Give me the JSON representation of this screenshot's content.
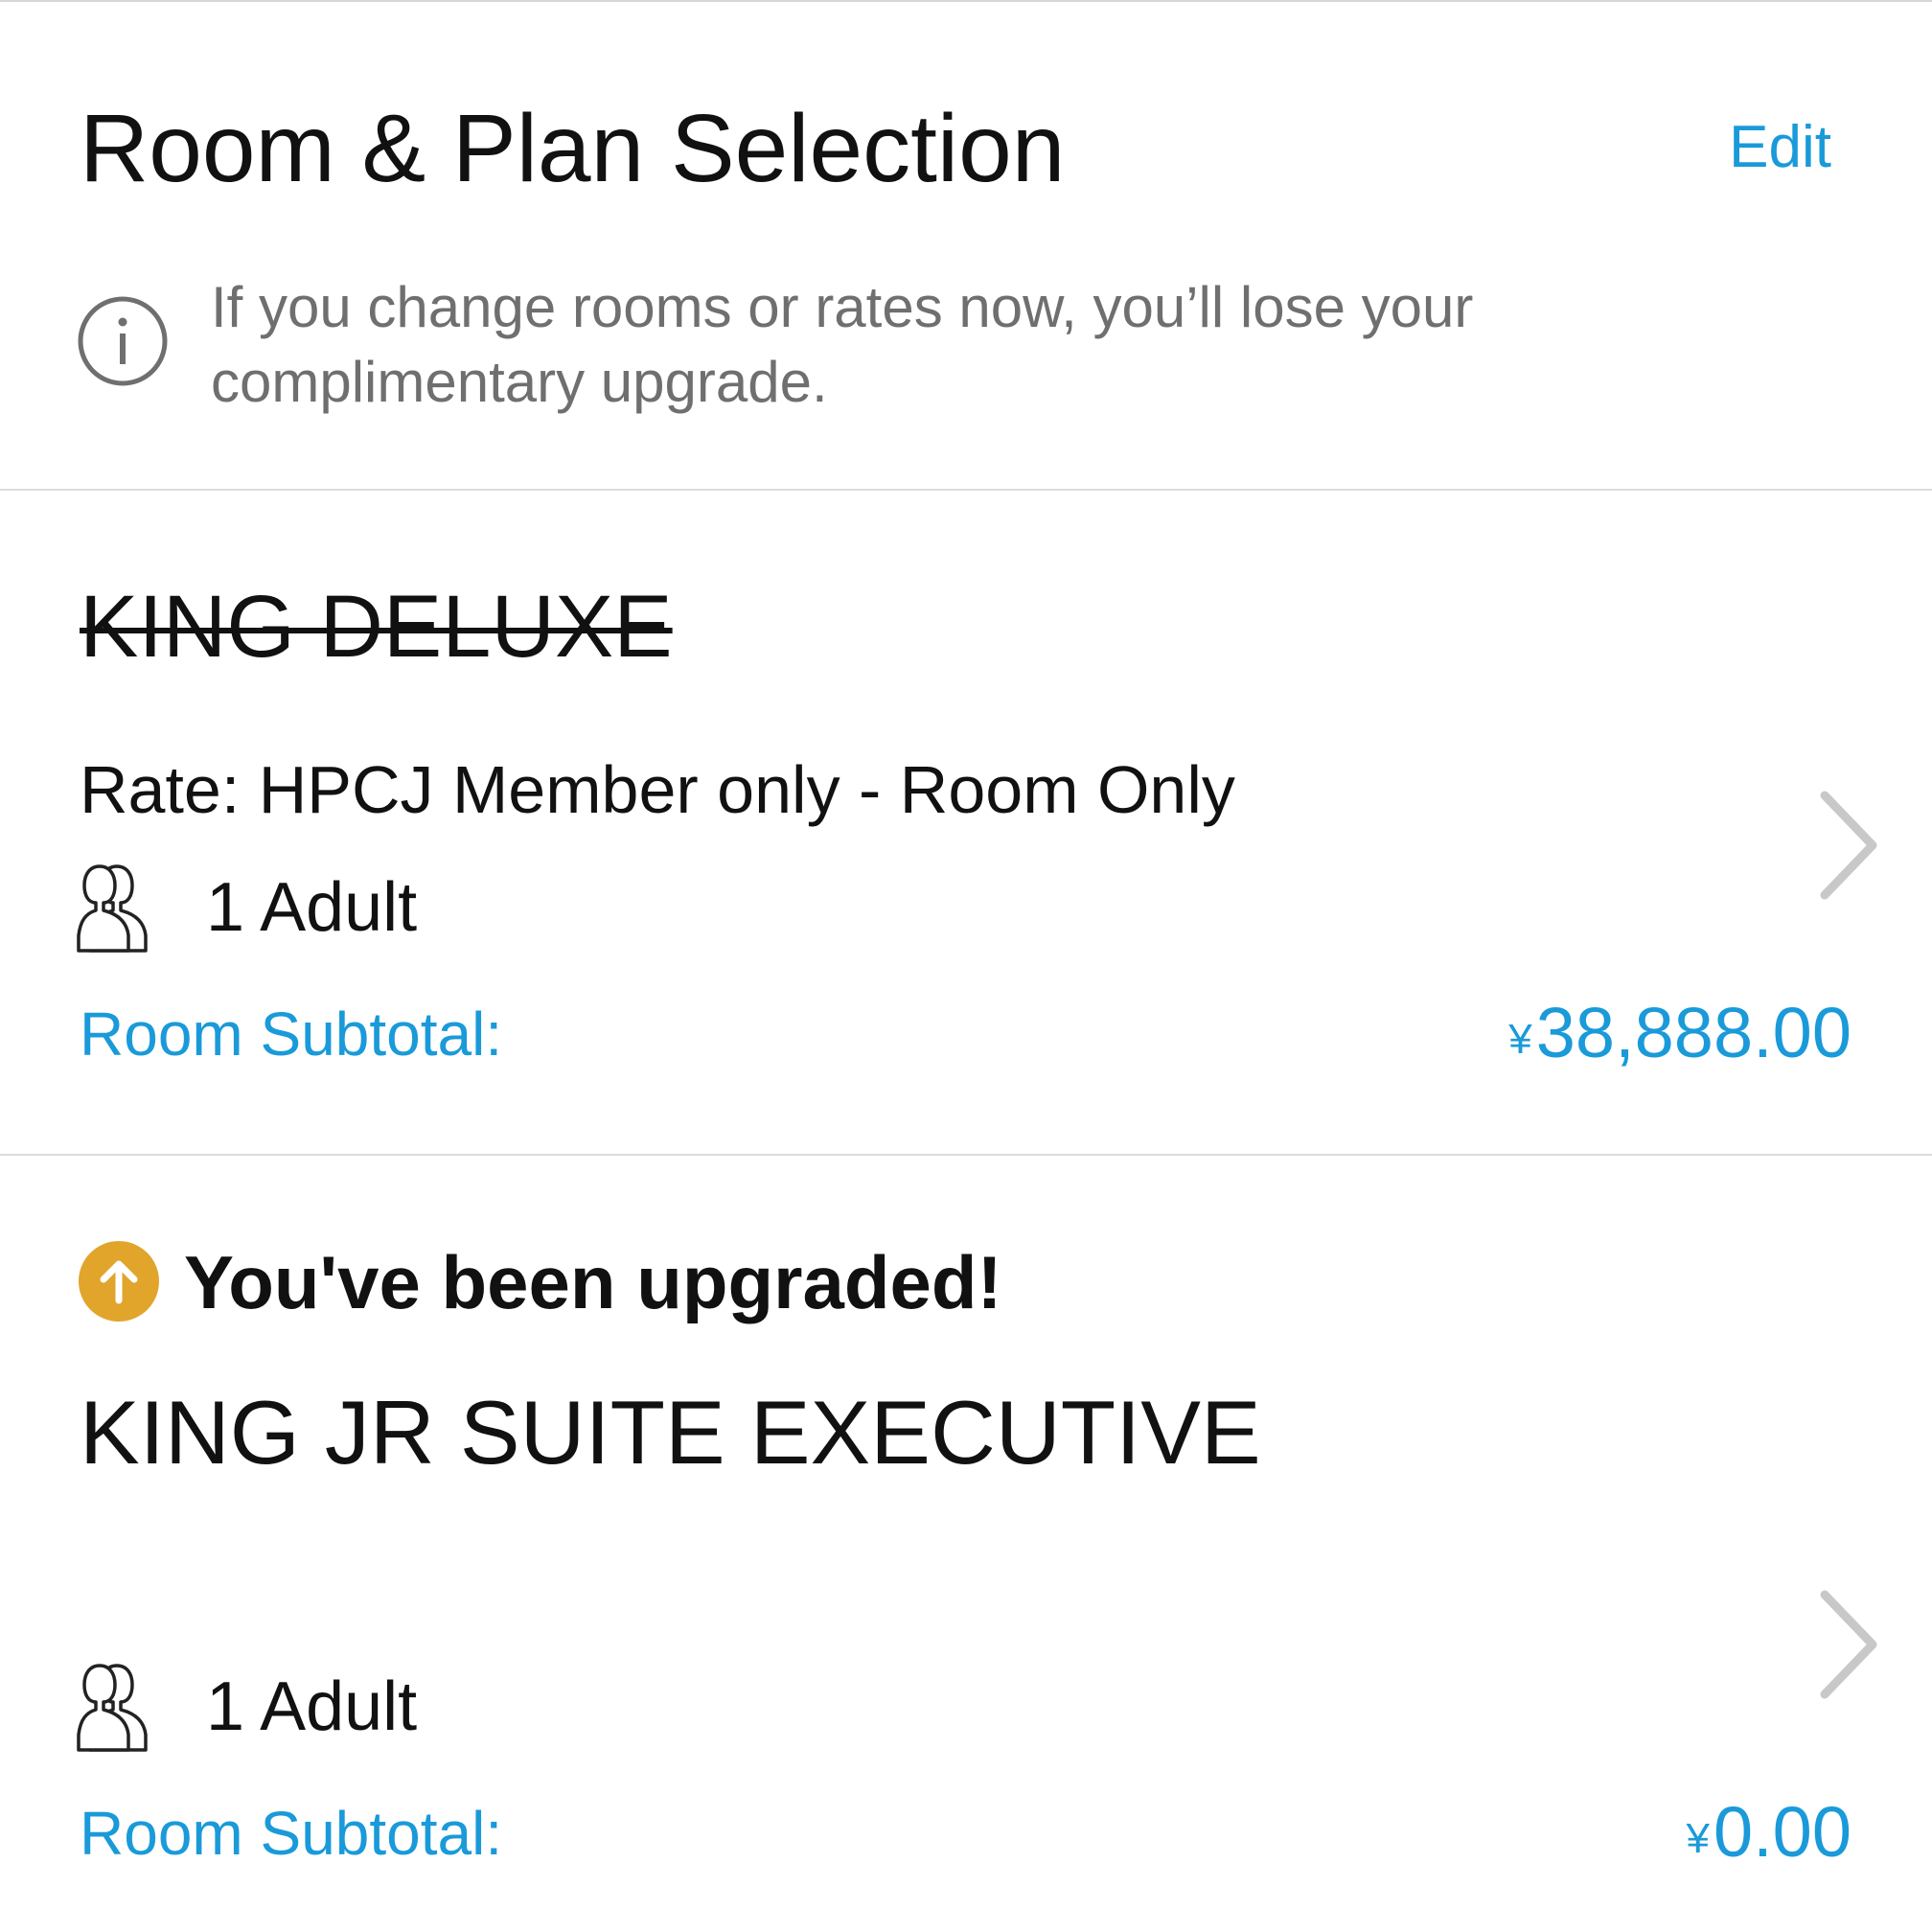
{
  "header": {
    "title": "Room & Plan Selection",
    "edit_label": "Edit"
  },
  "notice": {
    "icon": "info-icon",
    "text": "If you change rooms or rates now, you’ll lose your complimentary upgrade."
  },
  "original_room": {
    "name": "KING DELUXE",
    "name_struck_through": true,
    "rate": "Rate: HPCJ Member only - Room Only",
    "guests": "1 Adult",
    "subtotal_label": "Room Subtotal:",
    "currency": "¥",
    "subtotal_amount": "38,888.00"
  },
  "upgraded_room": {
    "badge_icon": "upgrade-arrow-icon",
    "badge_text": "You've been upgraded!",
    "name": "KING JR SUITE EXECUTIVE",
    "guests": "1 Adult",
    "subtotal_label": "Room Subtotal:",
    "currency": "¥",
    "subtotal_amount": "0.00"
  },
  "colors": {
    "accent": "#1a9ad9",
    "upgrade_badge": "#e1a52c",
    "secondary_text": "#6f6f6f",
    "chevron": "#c8c8c8",
    "divider": "#dcdcdc"
  }
}
